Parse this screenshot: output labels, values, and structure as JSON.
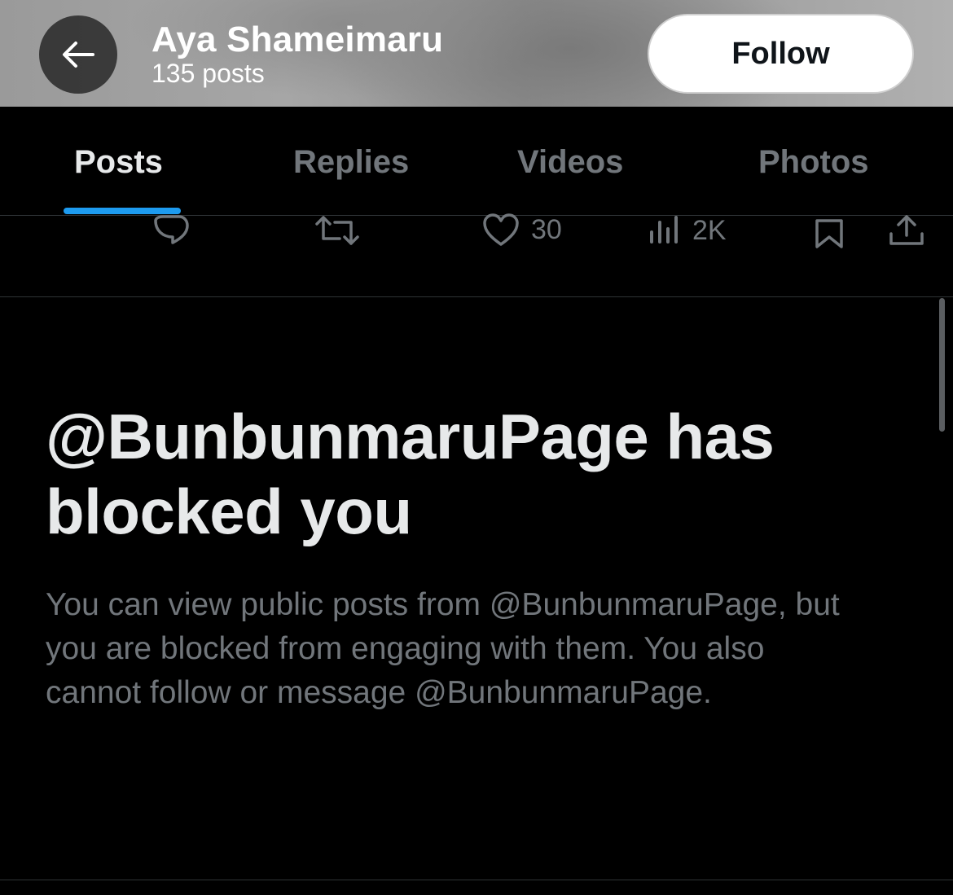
{
  "header": {
    "profile_name": "Aya Shameimaru",
    "post_count": "135 posts",
    "follow_label": "Follow",
    "back_icon": "arrow-left-icon"
  },
  "tabs": [
    {
      "label": "Posts",
      "active": true
    },
    {
      "label": "Replies",
      "active": false
    },
    {
      "label": "Videos",
      "active": false
    },
    {
      "label": "Photos",
      "active": false
    }
  ],
  "actions": {
    "reply_icon": "reply-icon",
    "repost_icon": "repost-icon",
    "like_icon": "heart-icon",
    "like_count": "30",
    "views_icon": "views-icon",
    "views_count": "2K",
    "bookmark_icon": "bookmark-icon",
    "share_icon": "share-icon"
  },
  "blocked": {
    "title": "@BunbunmaruPage has blocked you",
    "description": "You can view public posts from @BunbunmaruPage, but you are blocked from engaging with them. You also cannot follow or message @BunbunmaruPage."
  },
  "colors": {
    "accent": "#1d9bf0",
    "background": "#000000",
    "primary_text": "#e7e9ea",
    "secondary_text": "#71767b"
  }
}
